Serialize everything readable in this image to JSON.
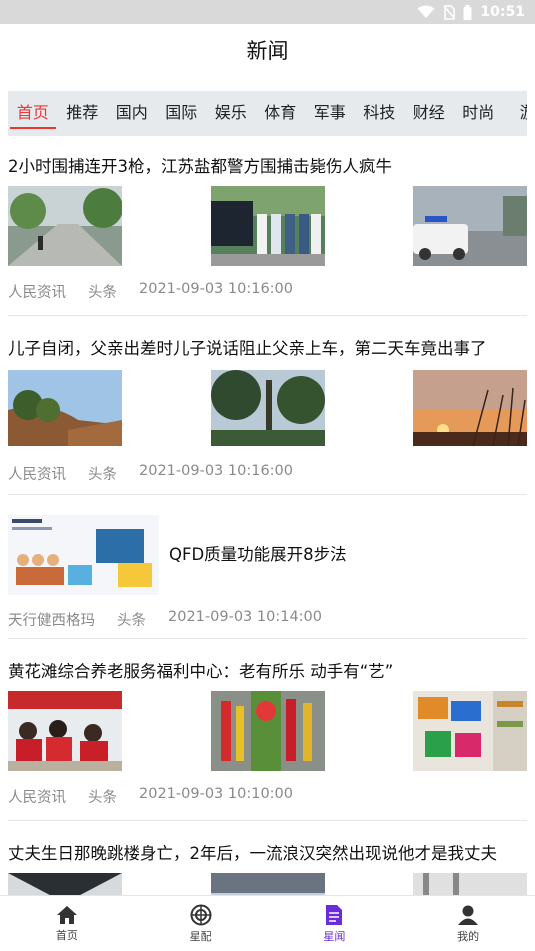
{
  "status": {
    "time": "10:51"
  },
  "header": {
    "title": "新闻"
  },
  "tabs": [
    {
      "label": "首页",
      "active": true
    },
    {
      "label": "推荐"
    },
    {
      "label": "国内"
    },
    {
      "label": "国际"
    },
    {
      "label": "娱乐"
    },
    {
      "label": "体育"
    },
    {
      "label": "军事"
    },
    {
      "label": "科技"
    },
    {
      "label": "财经"
    },
    {
      "label": "时尚"
    },
    {
      "label": "游"
    }
  ],
  "news": [
    {
      "title": "2小时围捕连开3枪，江苏盐都警方围捕击毙伤人疯牛",
      "source": "人民资讯",
      "tag": "头条",
      "time": "2021-09-03 10:16:00"
    },
    {
      "title": "儿子自闭，父亲出差时儿子说话阻止父亲上车，第二天车竟出事了",
      "source": "人民资讯",
      "tag": "头条",
      "time": "2021-09-03 10:16:00"
    },
    {
      "title": "QFD质量功能展开8步法",
      "source": "天行健西格玛",
      "tag": "头条",
      "time": "2021-09-03 10:14:00"
    },
    {
      "title": "黄花滩综合养老服务福利中心：老有所乐 动手有“艺”",
      "source": "人民资讯",
      "tag": "头条",
      "time": "2021-09-03 10:10:00"
    },
    {
      "title": "丈夫生日那晚跳楼身亡，2年后，一流浪汉突然出现说他才是我丈夫"
    }
  ],
  "bottom_nav": [
    {
      "label": "首页",
      "icon": "home-icon"
    },
    {
      "label": "星配",
      "icon": "target-icon"
    },
    {
      "label": "星闻",
      "icon": "document-icon",
      "active": true
    },
    {
      "label": "我的",
      "icon": "user-icon"
    }
  ],
  "colors": {
    "accent": "#e53935",
    "nav_active": "#6a2bd9",
    "tab_bar": "#e6eaed"
  }
}
